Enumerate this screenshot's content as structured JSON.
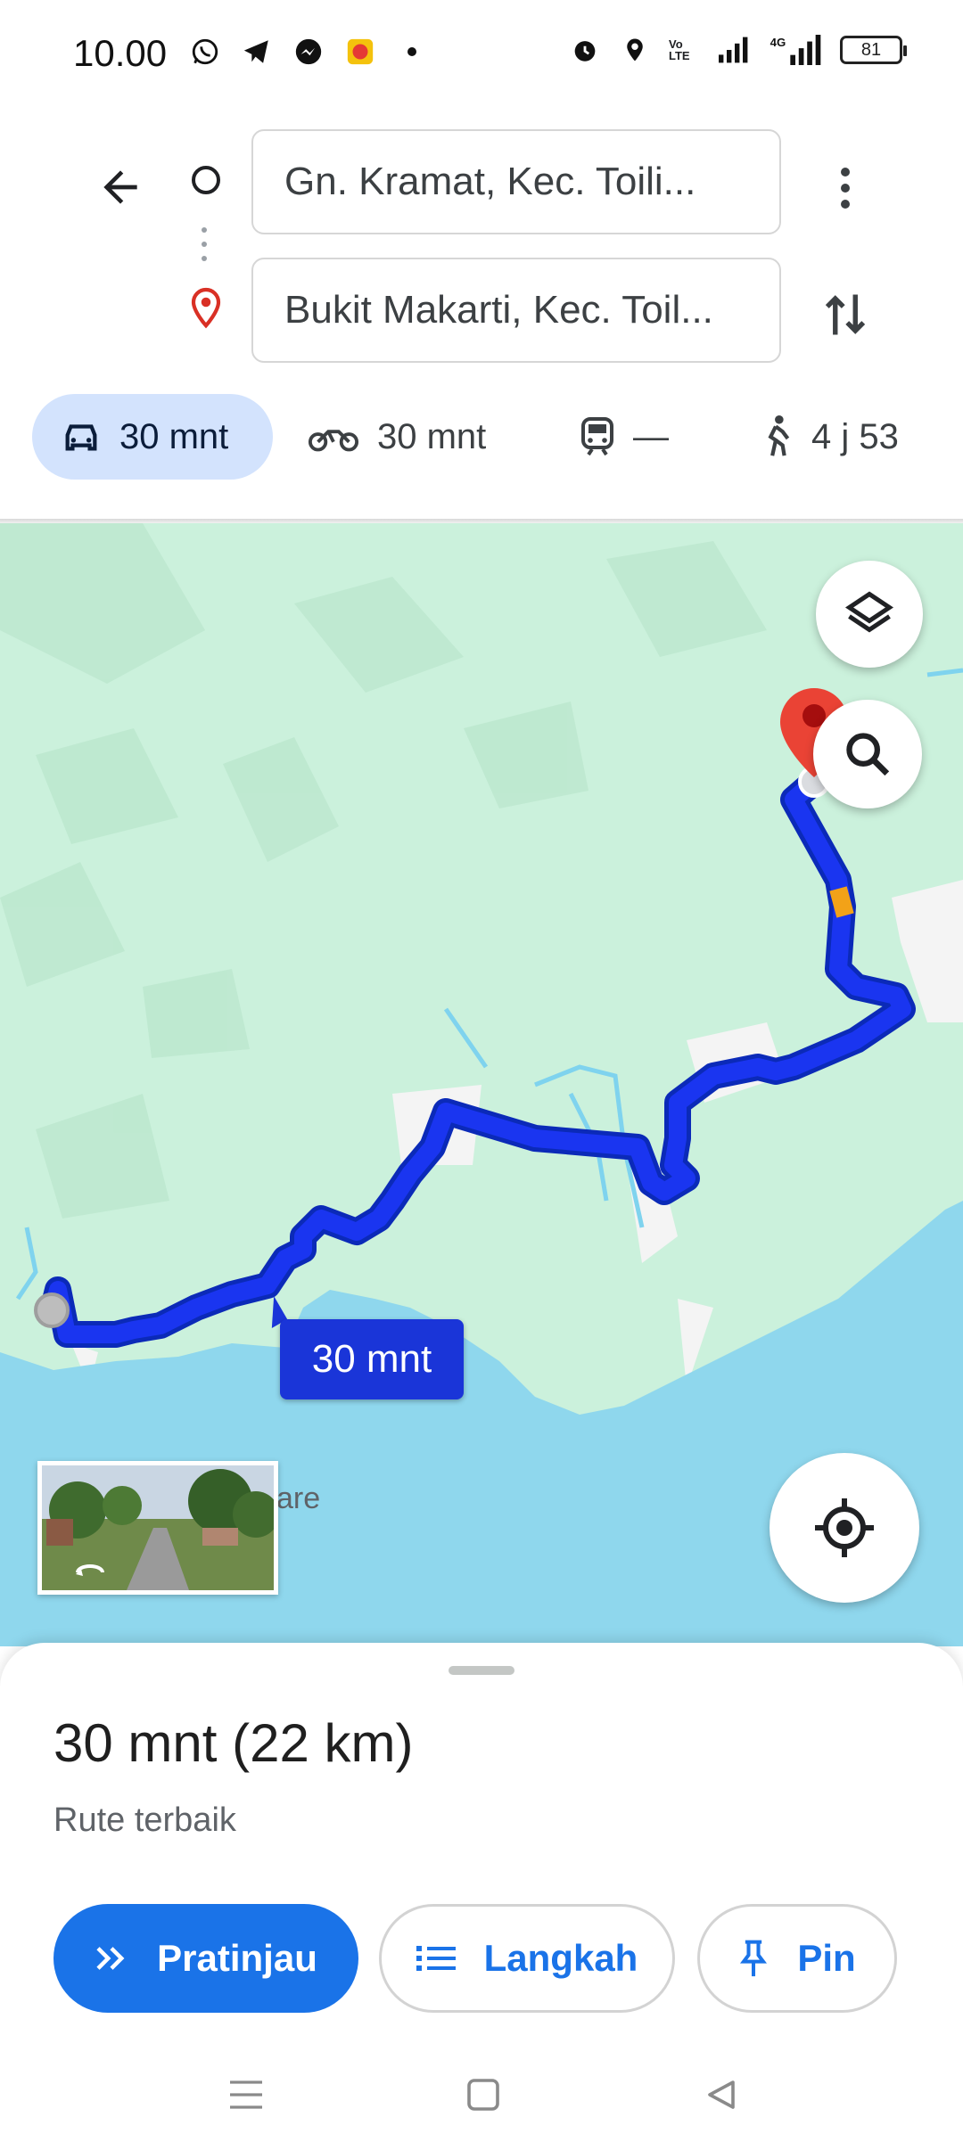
{
  "status_bar": {
    "time": "10.00",
    "battery": "81",
    "network": "4G",
    "volte": "Vo LTE"
  },
  "directions": {
    "origin": "Gn. Kramat, Kec. Toili...",
    "destination": "Bukit Makarti, Kec. Toil..."
  },
  "modes": [
    {
      "name": "car",
      "label": "30 mnt",
      "active": true
    },
    {
      "name": "motorcycle",
      "label": "30 mnt"
    },
    {
      "name": "transit",
      "label": "—"
    },
    {
      "name": "walk",
      "label": "4 j 53"
    }
  ],
  "map": {
    "eta_label": "30 mnt",
    "place_label": "are",
    "route_color": "#1a35f0",
    "water_color": "#8fd7ed",
    "land_color": "#cbf1dc",
    "destination_pin_color": "#ea4335"
  },
  "sheet": {
    "summary": "30 mnt (22 km)",
    "subtitle": "Rute terbaik",
    "preview_label": "Pratinjau",
    "steps_label": "Langkah",
    "pin_label": "Pin"
  },
  "colors": {
    "accent": "#1a73e8",
    "active_mode_bg": "#d3e3fd"
  }
}
